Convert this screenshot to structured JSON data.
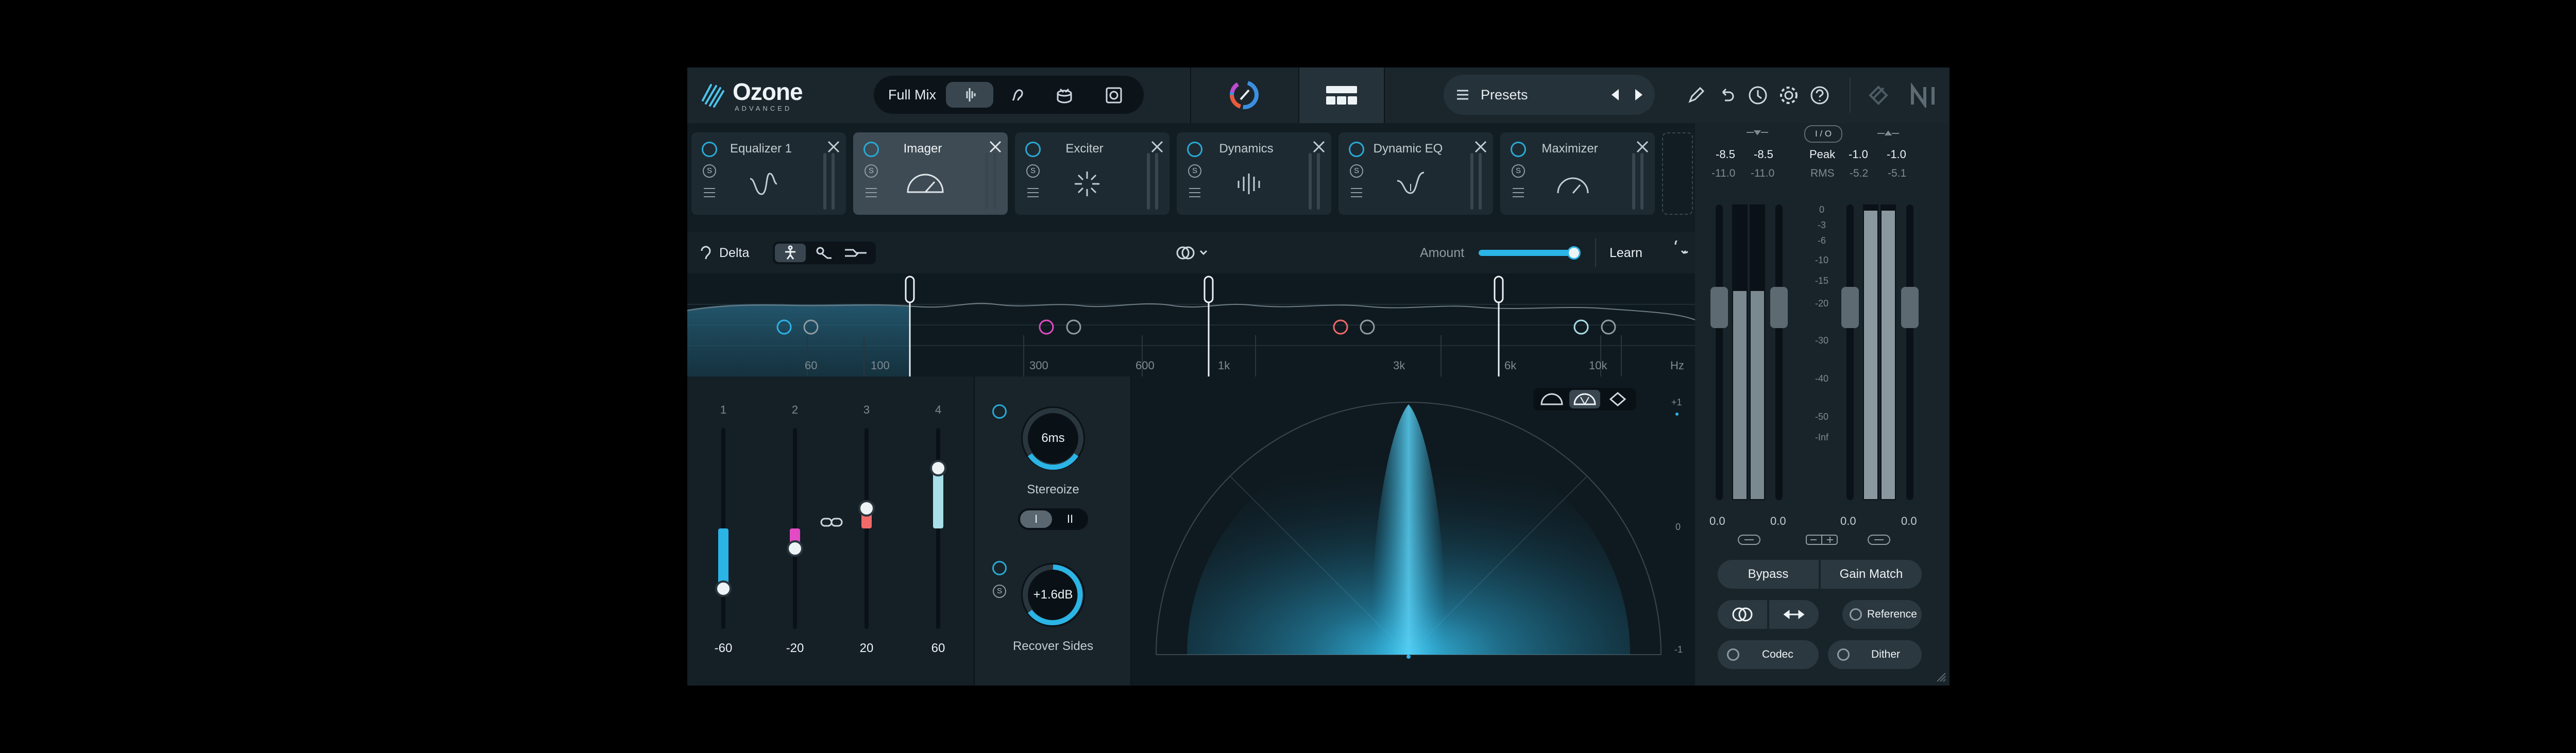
{
  "app": {
    "logo_name": "Ozone",
    "logo_sub": "ADVANCED",
    "mix_label": "Full Mix",
    "presets_label": "Presets"
  },
  "modules": [
    {
      "label": "Equalizer 1"
    },
    {
      "label": "Imager"
    },
    {
      "label": "Exciter"
    },
    {
      "label": "Dynamics"
    },
    {
      "label": "Dynamic EQ"
    },
    {
      "label": "Maximizer"
    }
  ],
  "toolbar": {
    "delta_label": "Delta",
    "amount_label": "Amount",
    "learn_label": "Learn"
  },
  "spectrum": {
    "freq_labels": [
      "60",
      "100",
      "300",
      "600",
      "1k",
      "3k",
      "6k",
      "10k",
      "Hz"
    ]
  },
  "bands": {
    "numbers": [
      "1",
      "2",
      "3",
      "4"
    ],
    "values": [
      "-60",
      "-20",
      "20",
      "60"
    ],
    "fader_levels": [
      -60,
      -20,
      20,
      60
    ],
    "colors": [
      "#2bb4e6",
      "#e24bc4",
      "#f06a6a",
      "#a8dfe8"
    ]
  },
  "stereoize": {
    "knob_value": "6ms",
    "label": "Stereoize",
    "mode_1": "I",
    "mode_2": "II"
  },
  "recover": {
    "knob_value": "+1.6dB",
    "label": "Recover Sides"
  },
  "vectorscope": {
    "scale_top": "+1",
    "scale_mid": "0",
    "scale_bottom": "-1"
  },
  "meters": {
    "io_label": "I / O",
    "peak_label": "Peak",
    "rms_label": "RMS",
    "in_peak": [
      "-8.5",
      "-8.5"
    ],
    "in_rms": [
      "-11.0",
      "-11.0"
    ],
    "out_peak": [
      "-1.0",
      "-1.0"
    ],
    "out_rms": [
      "-5.2",
      "-5.1"
    ],
    "scale": [
      "0",
      "-3",
      "-6",
      "-10",
      "-15",
      "-20",
      "-30",
      "-40",
      "-50",
      "-Inf"
    ],
    "gain_values": [
      "0.0",
      "0.0",
      "0.0",
      "0.0"
    ],
    "bypass_label": "Bypass",
    "gain_match_label": "Gain Match",
    "reference_label": "Reference",
    "codec_label": "Codec",
    "dither_label": "Dither"
  },
  "colors": {
    "accent": "#28a9d6",
    "background": "#111c23"
  }
}
